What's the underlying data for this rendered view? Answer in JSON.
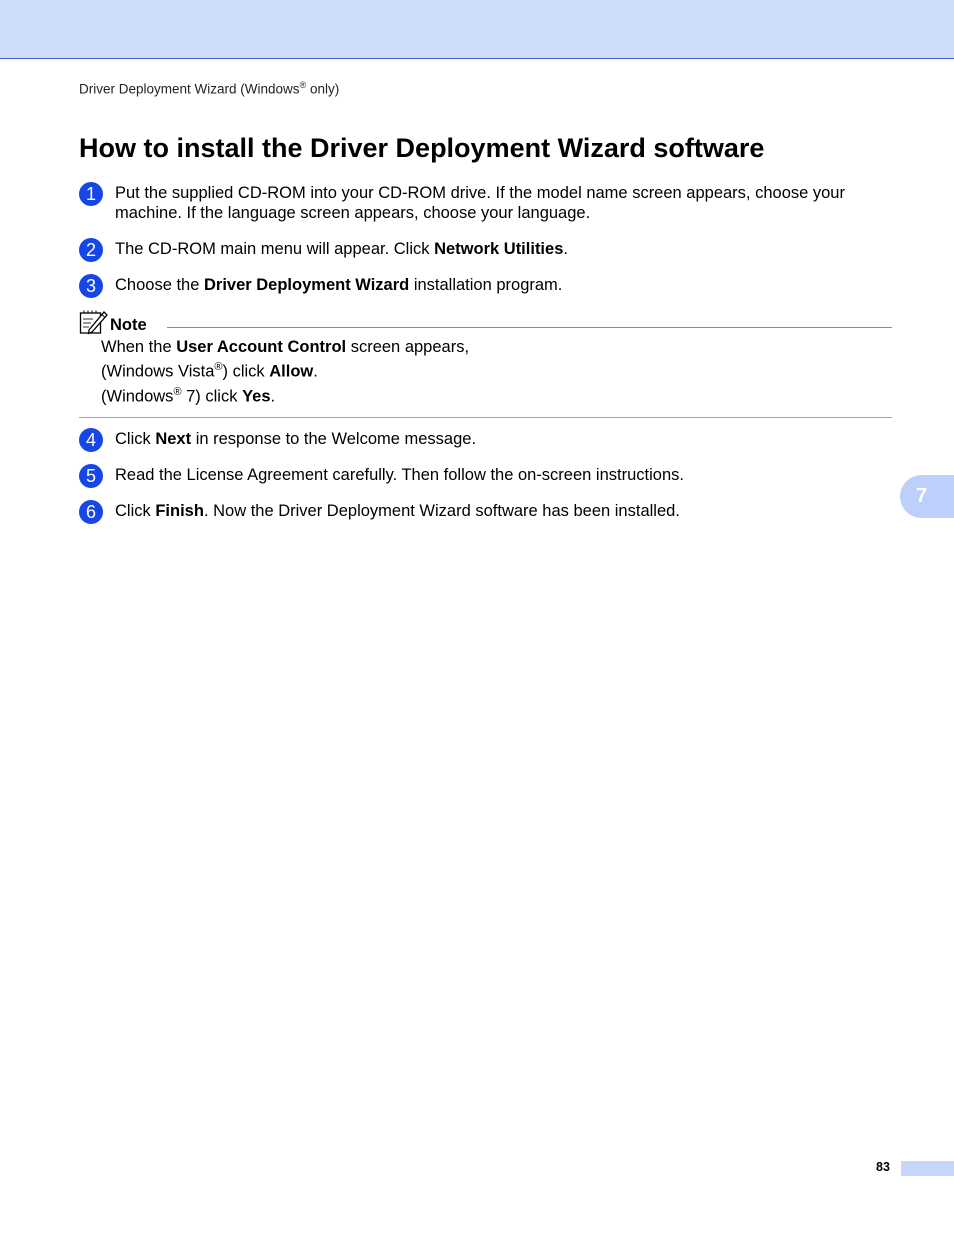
{
  "header": {
    "running_title_pre": "Driver Deployment Wizard (Windows",
    "running_title_sup": "®",
    "running_title_post": " only)"
  },
  "title": "How to install the Driver Deployment Wizard software",
  "steps": [
    {
      "num": "1",
      "text": "Put the supplied CD-ROM into your CD-ROM drive. If the model name screen appears, choose your machine. If the language screen appears, choose your language."
    },
    {
      "num": "2",
      "pre": "The CD-ROM main menu will appear. Click ",
      "bold": "Network Utilities",
      "post": "."
    },
    {
      "num": "3",
      "pre": "Choose the ",
      "bold": "Driver Deployment Wizard",
      "post": " installation program."
    },
    {
      "num": "4",
      "pre": "Click ",
      "bold": "Next",
      "post": " in response to the Welcome message."
    },
    {
      "num": "5",
      "text": "Read the License Agreement carefully. Then follow the on-screen instructions."
    },
    {
      "num": "6",
      "pre": "Click ",
      "bold": "Finish",
      "post": ". Now the Driver Deployment Wizard software has been installed."
    }
  ],
  "note": {
    "label": "Note",
    "line1_pre": "When the ",
    "line1_bold": "User Account Control",
    "line1_post": " screen appears,",
    "line2_pre": "(Windows Vista",
    "line2_sup": "®",
    "line2_mid": ") click ",
    "line2_bold": "Allow",
    "line2_post": ".",
    "line3_pre": "(Windows",
    "line3_sup": "®",
    "line3_mid": " 7) click ",
    "line3_bold": "Yes",
    "line3_post": "."
  },
  "side_tab": "7",
  "footer": {
    "page_number": "83"
  },
  "colors": {
    "accent": "#1746e6",
    "band": "#cddcfb",
    "rule": "#6c8ee8"
  },
  "icons": {
    "note": "pencil-notepad-icon"
  }
}
